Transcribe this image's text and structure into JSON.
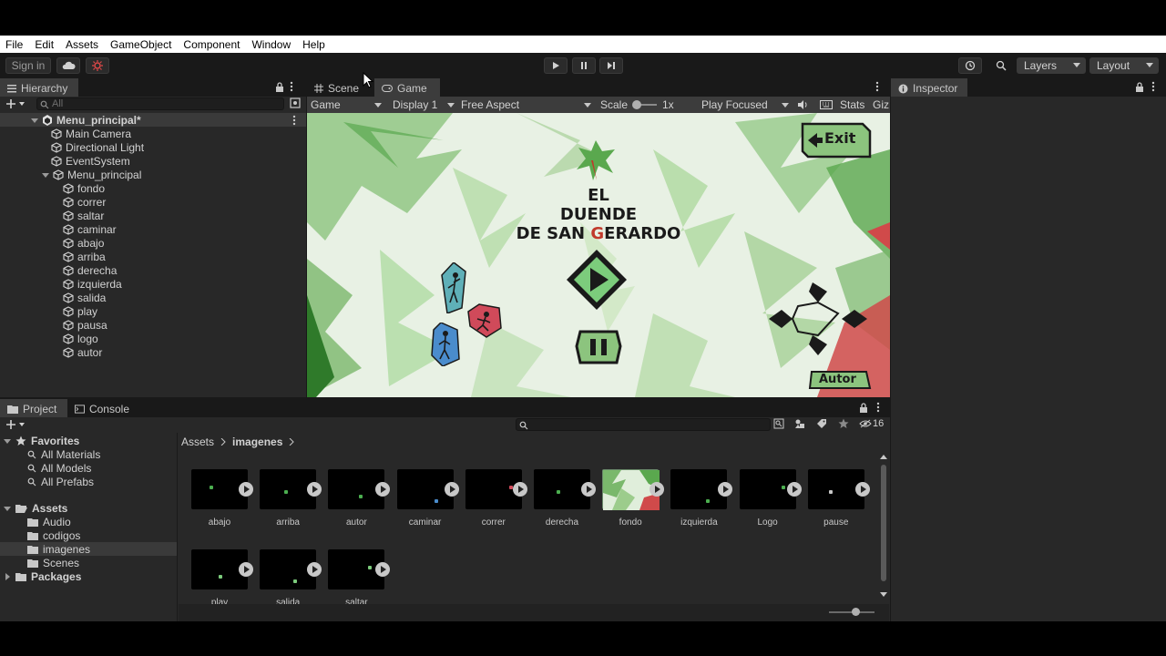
{
  "menu": [
    "File",
    "Edit",
    "Assets",
    "GameObject",
    "Component",
    "Window",
    "Help"
  ],
  "toolbar": {
    "sign_in": "Sign in",
    "layers": "Layers",
    "layout": "Layout"
  },
  "hierarchy": {
    "tab": "Hierarchy",
    "search_placeholder": "All",
    "scene_name": "Menu_principal*",
    "items": [
      "Main Camera",
      "Directional Light",
      "EventSystem",
      "Menu_principal"
    ],
    "children": [
      "fondo",
      "correr",
      "saltar",
      "caminar",
      "abajo",
      "arriba",
      "derecha",
      "izquierda",
      "salida",
      "play",
      "pausa",
      "logo",
      "autor"
    ]
  },
  "scene_tabs": {
    "scene": "Scene",
    "game": "Game"
  },
  "game_bar": {
    "display_mode": "Game",
    "display": "Display 1",
    "aspect": "Free Aspect",
    "scale_label": "Scale",
    "scale_value": "1x",
    "play_mode": "Play Focused",
    "stats": "Stats",
    "gizmos": "Giz"
  },
  "game_view": {
    "title_line1": "EL",
    "title_line2": "DUENDE",
    "title_line3_pre": "DE SAN ",
    "title_line3_g": "G",
    "title_line3_post": "ERARDO",
    "exit_label": "Exit",
    "autor_label": "Autor"
  },
  "inspector": {
    "tab": "Inspector"
  },
  "project": {
    "tab_project": "Project",
    "tab_console": "Console",
    "hidden_count": "16",
    "favorites_label": "Favorites",
    "favorites": [
      "All Materials",
      "All Models",
      "All Prefabs"
    ],
    "assets_label": "Assets",
    "asset_folders": [
      "Audio",
      "codigos",
      "imagenes",
      "Scenes"
    ],
    "packages_label": "Packages",
    "breadcrumb_root": "Assets",
    "breadcrumb_current": "imagenes",
    "files": [
      "abajo",
      "arriba",
      "autor",
      "caminar",
      "correr",
      "derecha",
      "fondo",
      "izquierda",
      "Logo",
      "pause",
      "play",
      "salida",
      "saltar"
    ]
  },
  "colors": {
    "accent_green": "#7ccc7c",
    "game_bg": "#e4efe0",
    "title_red": "#c0392b"
  }
}
